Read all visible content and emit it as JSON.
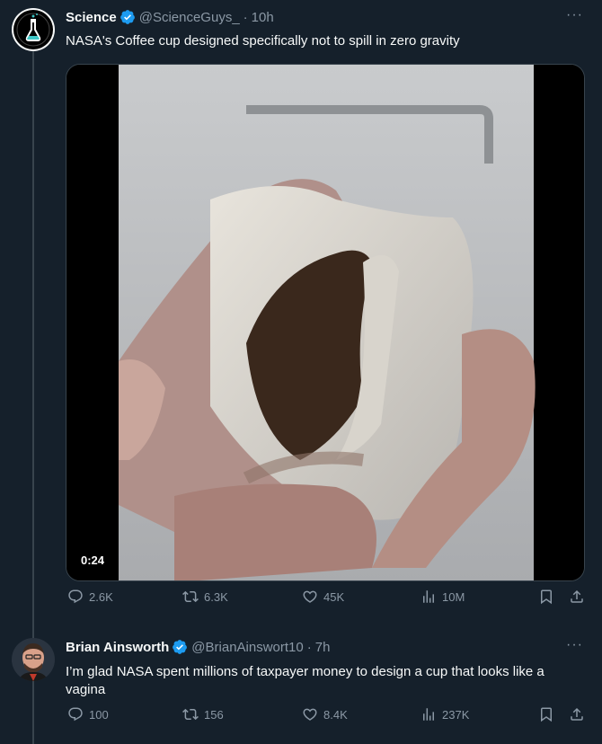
{
  "tweet1": {
    "name": "Science",
    "handle": "@ScienceGuys_",
    "time": "10h",
    "text": "NASA's Coffee cup designed specifically not to spill in zero gravity",
    "video_duration": "0:24",
    "replies": "2.6K",
    "retweets": "6.3K",
    "likes": "45K",
    "views": "10M"
  },
  "tweet2": {
    "name": "Brian Ainsworth",
    "handle": "@BrianAinswort10",
    "time": "7h",
    "text": "I’m glad NASA spent millions of taxpayer money to design a cup that looks like a vagina",
    "replies": "100",
    "retweets": "156",
    "likes": "8.4K",
    "views": "237K"
  },
  "icons": {
    "verified_color": "#1d9bf0",
    "muted_color": "#8b98a5"
  },
  "separator": "·",
  "more_label": "···"
}
